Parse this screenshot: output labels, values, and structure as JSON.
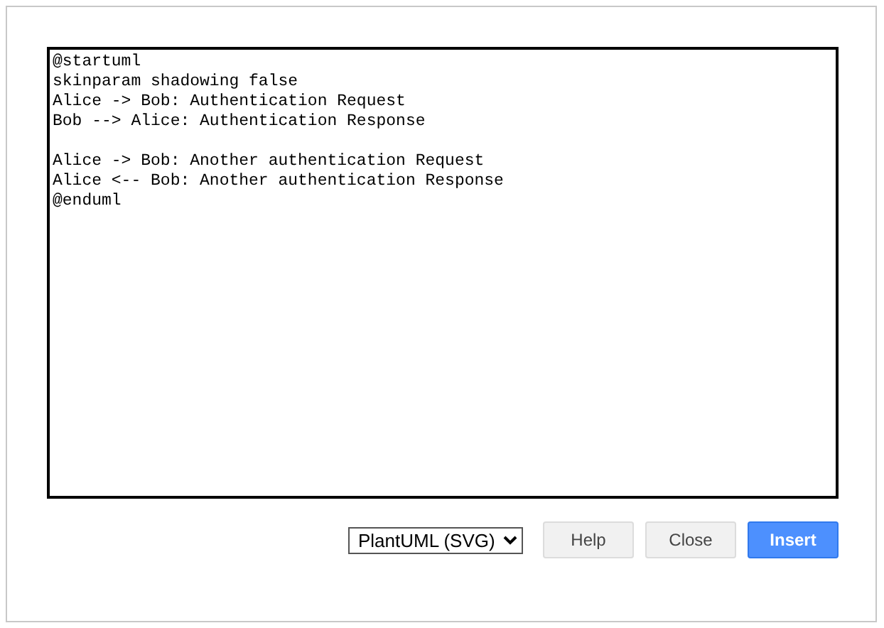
{
  "editor": {
    "value": "@startuml\nskinparam shadowing false\nAlice -> Bob: Authentication Request\nBob --> Alice: Authentication Response\n\nAlice -> Bob: Another authentication Request\nAlice <-- Bob: Another authentication Response\n@enduml"
  },
  "format_select": {
    "value": "PlantUML (SVG)"
  },
  "buttons": [
    {
      "label": "Help",
      "kind": "default"
    },
    {
      "label": "Close",
      "kind": "default"
    },
    {
      "label": "Insert",
      "kind": "primary"
    }
  ]
}
